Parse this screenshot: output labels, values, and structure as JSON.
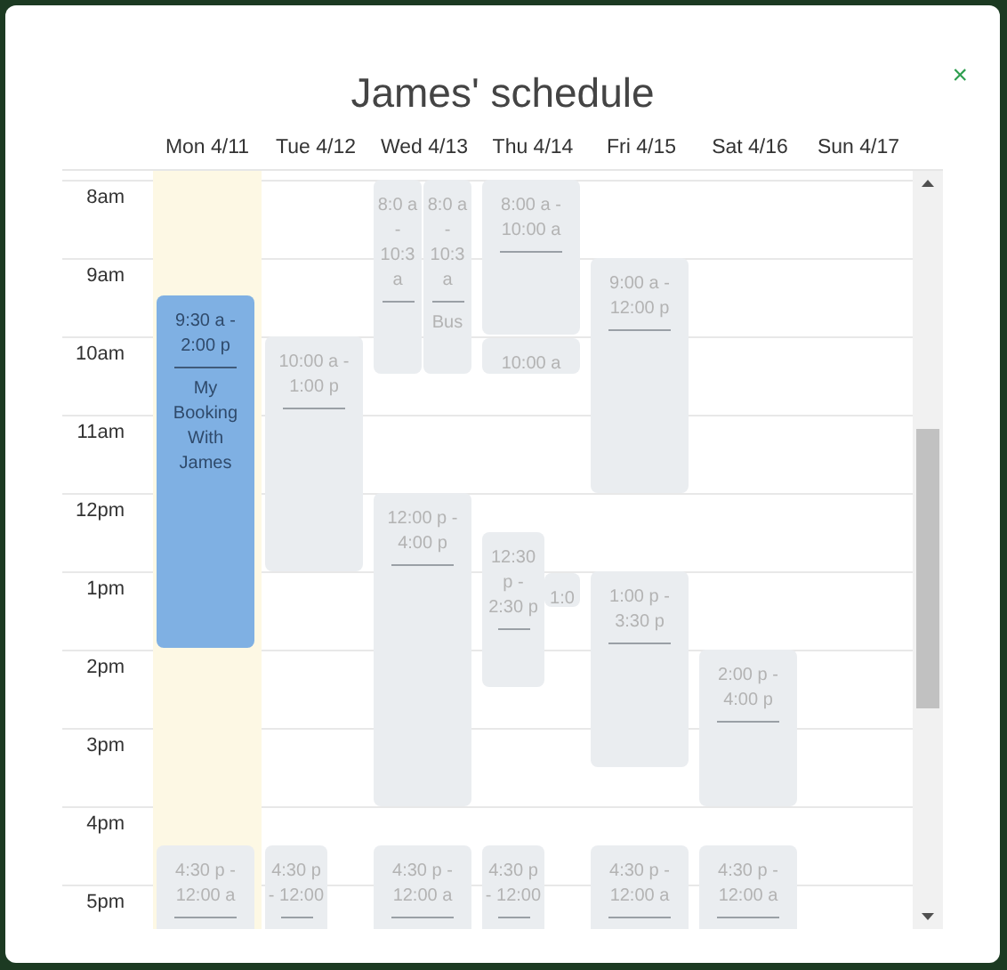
{
  "dialog": {
    "title": "James' schedule",
    "close": "×"
  },
  "hours": [
    "8am",
    "9am",
    "10am",
    "11am",
    "12pm",
    "1pm",
    "2pm",
    "3pm",
    "4pm",
    "5pm"
  ],
  "days": [
    {
      "label": "Mon 4/11",
      "today": true,
      "events": [
        {
          "kind": "booking",
          "time": "9:30 a - 2:00 p",
          "title": "My Booking With James"
        },
        {
          "kind": "busy",
          "time": "4:30 p - 12:00 a"
        }
      ]
    },
    {
      "label": "Tue 4/12",
      "events": [
        {
          "kind": "busy",
          "time": "10:00 a - 1:00 p"
        },
        {
          "kind": "busy",
          "time": "4:30 p - 12:00"
        }
      ]
    },
    {
      "label": "Wed 4/13",
      "events": [
        {
          "kind": "busy",
          "time": "8:0 a - 10:3 a"
        },
        {
          "kind": "busy",
          "time": "8:0 a - 10:3 a",
          "title": "Bus"
        },
        {
          "kind": "busy",
          "time": "12:00 p - 4:00 p"
        },
        {
          "kind": "busy",
          "time": "4:30 p - 12:00 a"
        }
      ]
    },
    {
      "label": "Thu 4/14",
      "events": [
        {
          "kind": "busy",
          "time": "8:00 a - 10:00 a"
        },
        {
          "kind": "busy",
          "time": "10:00 a"
        },
        {
          "kind": "busy",
          "time": "12:30 p - 2:30 p"
        },
        {
          "kind": "busy",
          "time": "1:0"
        },
        {
          "kind": "busy",
          "time": "4:30 p - 12:00"
        }
      ]
    },
    {
      "label": "Fri 4/15",
      "events": [
        {
          "kind": "busy",
          "time": "9:00 a - 12:00 p"
        },
        {
          "kind": "busy",
          "time": "1:00 p - 3:30 p"
        },
        {
          "kind": "busy",
          "time": "4:30 p - 12:00 a"
        }
      ]
    },
    {
      "label": "Sat 4/16",
      "events": [
        {
          "kind": "busy",
          "time": "2:00 p - 4:00 p"
        },
        {
          "kind": "busy",
          "time": "4:30 p - 12:00 a"
        }
      ]
    },
    {
      "label": "Sun 4/17"
    }
  ]
}
